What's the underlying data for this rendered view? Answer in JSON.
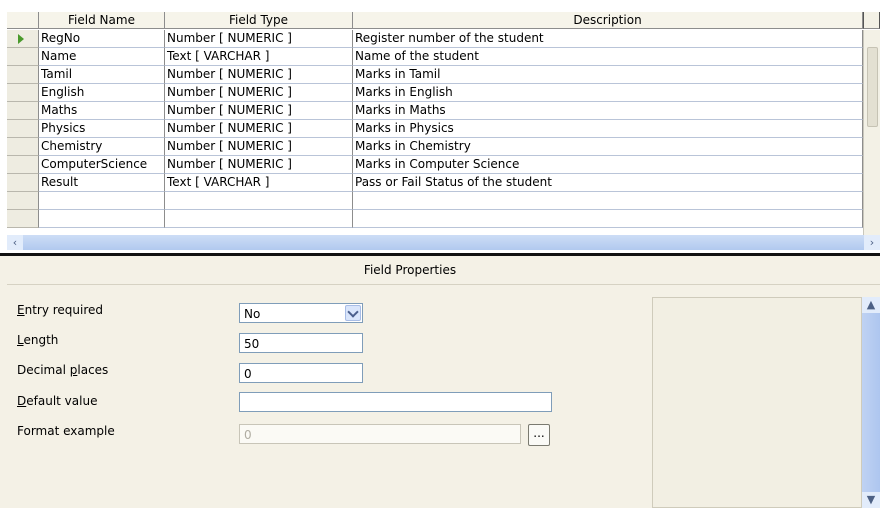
{
  "grid": {
    "headers": [
      "Field Name",
      "Field Type",
      "Description"
    ],
    "rows": [
      {
        "name": "RegNo",
        "type": "Number [ NUMERIC ]",
        "description": "Register number of the student"
      },
      {
        "name": "Name",
        "type": "Text [ VARCHAR ]",
        "description": "Name of the student"
      },
      {
        "name": "Tamil",
        "type": "Number [ NUMERIC ]",
        "description": "Marks in Tamil"
      },
      {
        "name": "English",
        "type": "Number [ NUMERIC ]",
        "description": "Marks in English"
      },
      {
        "name": "Maths",
        "type": "Number [ NUMERIC ]",
        "description": "Marks in Maths"
      },
      {
        "name": "Physics",
        "type": "Number [ NUMERIC ]",
        "description": "Marks in Physics"
      },
      {
        "name": "Chemistry",
        "type": "Number [ NUMERIC ]",
        "description": "Marks in Chemistry"
      },
      {
        "name": "ComputerScience",
        "type": "Number [ NUMERIC ]",
        "description": "Marks in Computer Science"
      },
      {
        "name": "Result",
        "type": "Text [ VARCHAR ]",
        "description": "Pass or Fail Status of the student"
      },
      {
        "name": "",
        "type": "",
        "description": ""
      },
      {
        "name": "",
        "type": "",
        "description": ""
      }
    ],
    "current_row_icon": "row-pointer-arrow-icon",
    "scroll_left_icon": "‹",
    "scroll_right_icon": "›"
  },
  "properties": {
    "title": "Field Properties",
    "entry_required": {
      "label": "Entry required",
      "mnemonic": "E",
      "rest": "ntry required",
      "value": "No"
    },
    "length": {
      "label": "Length",
      "mnemonic": "L",
      "rest": "ength",
      "value": "50"
    },
    "decimal_places": {
      "label": "Decimal places",
      "pre": "Decimal ",
      "mnemonic": "p",
      "rest": "laces",
      "value": "0"
    },
    "default_value": {
      "label": "Default value",
      "mnemonic": "D",
      "rest": "efault value",
      "value": ""
    },
    "format_example": {
      "label": "Format example",
      "value": "0",
      "button": "..."
    },
    "scroll_up_icon": "▲",
    "scroll_down_icon": "▼"
  },
  "colors": {
    "accent_blue": "#b1c9ef",
    "row_pointer": "#4a9a2c",
    "panel_bg": "#f4f1e6"
  }
}
